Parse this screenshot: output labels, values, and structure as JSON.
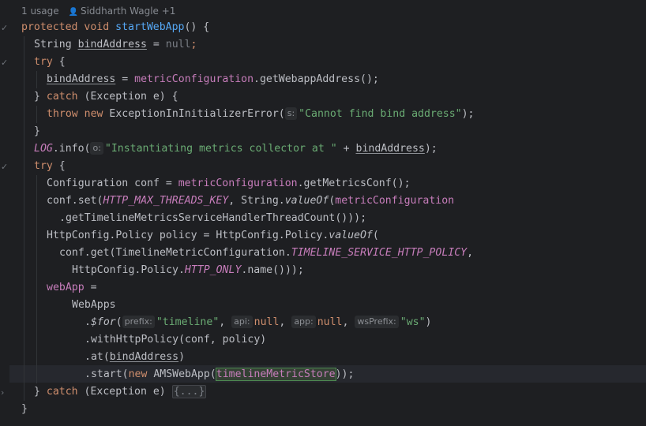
{
  "lens": {
    "usages": "1 usage",
    "authors": "Siddharth Wagle +1"
  },
  "code": {
    "l1": [
      "protected",
      "void",
      "startWebApp",
      "() {"
    ],
    "l2": [
      "String ",
      "bindAddress",
      " = ",
      "null",
      ";"
    ],
    "l3": [
      "try",
      " {"
    ],
    "l4": [
      "bindAddress",
      " = ",
      "metricConfiguration",
      ".getWebappAddress();"
    ],
    "l5": [
      "} ",
      "catch",
      " (Exception e) {"
    ],
    "l6": [
      "throw",
      "new",
      " ExceptionInInitializerError(",
      "s:",
      "\"Cannot find bind address\"",
      ");"
    ],
    "l7": [
      "}"
    ],
    "l8": [
      "LOG",
      ".info(",
      "o:",
      "\"Instantiating metrics collector at \"",
      " + ",
      "bindAddress",
      ");"
    ],
    "l9": [
      "try",
      " {"
    ],
    "l10": [
      "Configuration conf = ",
      "metricConfiguration",
      ".getMetricsConf();"
    ],
    "l11": [
      "conf.set(",
      "HTTP_MAX_THREADS_KEY",
      ", String.",
      "valueOf",
      "(",
      "metricConfiguration"
    ],
    "l12": [
      ".getTimelineMetricsServiceHandlerThreadCount()));"
    ],
    "l13": [
      "HttpConfig.Policy policy = HttpConfig.Policy.",
      "valueOf",
      "("
    ],
    "l14": [
      "conf.get(TimelineMetricConfiguration.",
      "TIMELINE_SERVICE_HTTP_POLICY",
      ","
    ],
    "l15": [
      "HttpConfig.Policy.",
      "HTTP_ONLY",
      ".name()));"
    ],
    "l16": [
      "webApp",
      " ="
    ],
    "l17": [
      "WebApps"
    ],
    "l18": [
      ".",
      "$for",
      "(",
      "prefix:",
      "\"timeline\"",
      ", ",
      "api:",
      "null",
      ", ",
      "app:",
      "null",
      ", ",
      "wsPrefix:",
      "\"ws\"",
      ")"
    ],
    "l19": [
      ".withHttpPolicy(conf, policy)"
    ],
    "l20": [
      ".at(",
      "bindAddress",
      ")"
    ],
    "l21": [
      ".start(",
      "new",
      " AMSWebApp(",
      "timelineMetricStore",
      "));"
    ],
    "l22": [
      "} ",
      "catch",
      " (Exception e) ",
      "{...}"
    ],
    "l23": [
      "}"
    ]
  },
  "colors": {
    "background": "#1e1f22",
    "keyword": "#cf8e6d",
    "string": "#6aab73",
    "field": "#c77dbb",
    "method": "#56a8f5"
  }
}
